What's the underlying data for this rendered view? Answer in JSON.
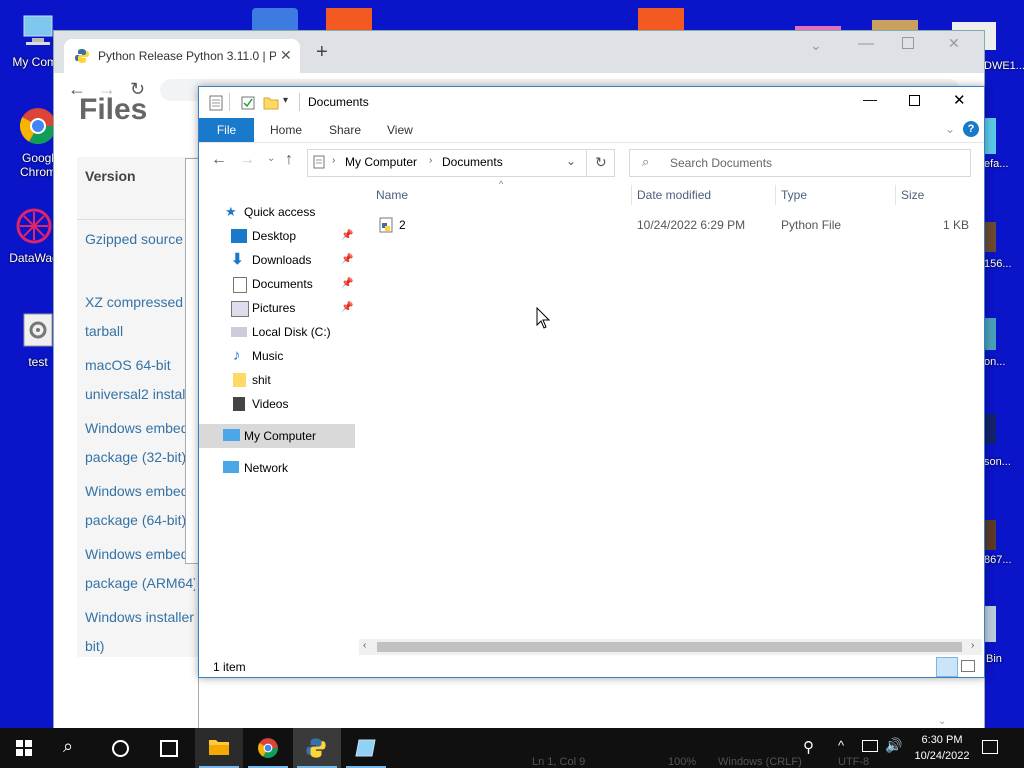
{
  "desktop": {
    "icons": [
      {
        "label": "My Comp",
        "icon": "computer-icon"
      },
      {
        "label": "Googl\nChrom",
        "icon": "chrome-icon"
      },
      {
        "label": "DataWag",
        "icon": "datawagon-icon"
      },
      {
        "label": "test",
        "icon": "gear-file-icon"
      }
    ],
    "right_labels": [
      "DWE1...",
      "efa...",
      "156...",
      "on...",
      "son...",
      "867...",
      "Bin"
    ]
  },
  "browser": {
    "tab_title": "Python Release Python 3.11.0 | P",
    "page": {
      "title": "Files",
      "version_header": "Version",
      "downloads": [
        "Gzipped source",
        "XZ compressed s",
        "tarball",
        "macOS 64-bit",
        "universal2 instal",
        "Windows embed",
        "package (32-bit)",
        "Windows embed",
        "package (64-bit)",
        "Windows embed",
        "package (ARM64)",
        "Windows installer",
        "bit)"
      ]
    }
  },
  "explorer": {
    "title": "Documents",
    "ribbon_tabs": {
      "file": "File",
      "home": "Home",
      "share": "Share",
      "view": "View"
    },
    "breadcrumb": {
      "root": "My Computer",
      "current": "Documents"
    },
    "search_placeholder": "Search Documents",
    "nav": {
      "quick_access": "Quick access",
      "items": [
        "Desktop",
        "Downloads",
        "Documents",
        "Pictures",
        "Local Disk (C:)",
        "Music",
        "shit",
        "Videos"
      ],
      "my_computer": "My Computer",
      "network": "Network"
    },
    "columns": {
      "name": "Name",
      "date": "Date modified",
      "type": "Type",
      "size": "Size"
    },
    "files": [
      {
        "name": "2",
        "date": "10/24/2022 6:29 PM",
        "type": "Python File",
        "size": "1 KB"
      }
    ],
    "status": "1 item"
  },
  "notepad_status": {
    "pos": "Ln 1, Col 9",
    "zoom": "100%",
    "eol": "Windows (CRLF)",
    "enc": "UTF-8"
  },
  "taskbar": {
    "time": "6:30 PM",
    "date": "10/24/2022"
  },
  "colors": {
    "desktop": "#0a14c8",
    "accent": "#1979ca",
    "taskbar": "#101010"
  }
}
